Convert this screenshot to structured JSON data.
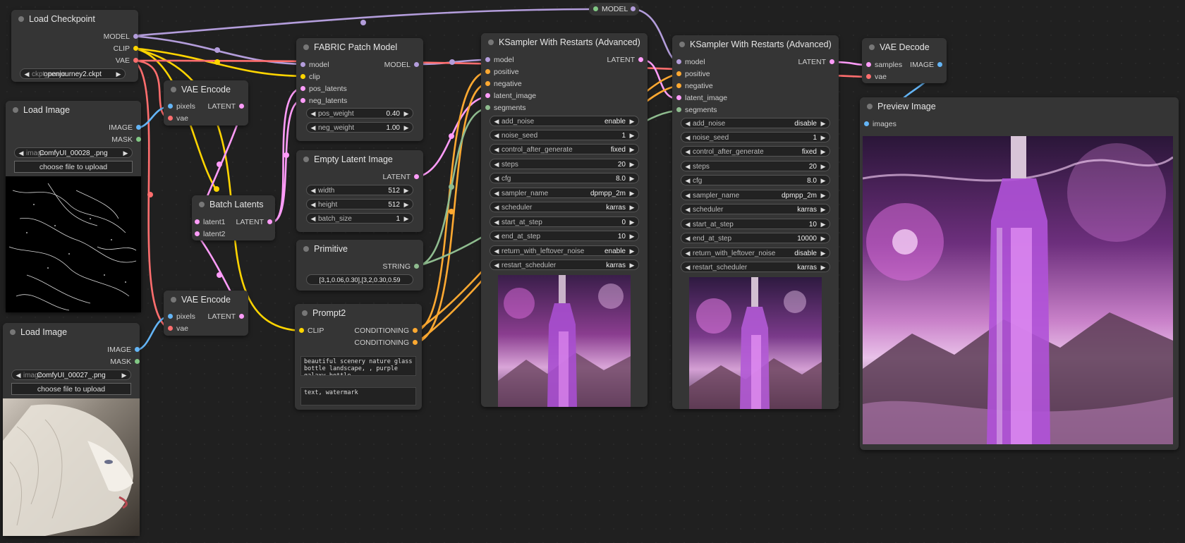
{
  "colors": {
    "model": "#b39ddb",
    "clip": "#ffd500",
    "vae": "#ff6e6e",
    "image": "#64b5f6",
    "mask": "#81c784",
    "latent": "#ff9cf9",
    "conditioning": "#ffa931",
    "string": "#8fbc8f"
  },
  "model_reroute": {
    "label": "MODEL"
  },
  "load_checkpoint": {
    "title": "Load Checkpoint",
    "outputs": [
      "MODEL",
      "CLIP",
      "VAE"
    ],
    "ckpt_label": "ckpt_name",
    "ckpt_value": "openjourney2.ckpt"
  },
  "load_image_1": {
    "title": "Load Image",
    "outputs": [
      "IMAGE",
      "MASK"
    ],
    "image_label": "image",
    "image_value": "ComfyUI_00028_.png",
    "upload_label": "choose file to upload"
  },
  "load_image_2": {
    "title": "Load Image",
    "outputs": [
      "IMAGE",
      "MASK"
    ],
    "image_label": "image",
    "image_value": "ComfyUI_00027_.png",
    "upload_label": "choose file to upload"
  },
  "vae_encode_1": {
    "title": "VAE Encode",
    "inputs": [
      "pixels",
      "vae"
    ],
    "output": "LATENT"
  },
  "vae_encode_2": {
    "title": "VAE Encode",
    "inputs": [
      "pixels",
      "vae"
    ],
    "output": "LATENT"
  },
  "batch_latents": {
    "title": "Batch Latents",
    "inputs": [
      "latent1",
      "latent2"
    ],
    "output": "LATENT"
  },
  "fabric": {
    "title": "FABRIC Patch Model",
    "inputs": [
      "model",
      "clip",
      "pos_latents",
      "neg_latents"
    ],
    "output": "MODEL",
    "widgets": [
      {
        "label": "pos_weight",
        "value": "0.40"
      },
      {
        "label": "neg_weight",
        "value": "1.00"
      }
    ]
  },
  "empty_latent": {
    "title": "Empty Latent Image",
    "output": "LATENT",
    "widgets": [
      {
        "label": "width",
        "value": "512"
      },
      {
        "label": "height",
        "value": "512"
      },
      {
        "label": "batch_size",
        "value": "1"
      }
    ]
  },
  "primitive": {
    "title": "Primitive",
    "output": "STRING",
    "value": "[3,1,0.06,0.30],[3,2,0.30,0.59"
  },
  "prompt2": {
    "title": "Prompt2",
    "input": "CLIP",
    "outputs": [
      "CONDITIONING",
      "CONDITIONING"
    ],
    "positive_text": "beautiful scenery nature glass bottle landscape, , purple galaxy bottle,",
    "negative_text": "text, watermark"
  },
  "ksampler_1": {
    "title": "KSampler With Restarts (Advanced)",
    "inputs": [
      "model",
      "positive",
      "negative",
      "latent_image",
      "segments"
    ],
    "output": "LATENT",
    "widgets": [
      {
        "label": "add_noise",
        "value": "enable"
      },
      {
        "label": "noise_seed",
        "value": "1"
      },
      {
        "label": "control_after_generate",
        "value": "fixed"
      },
      {
        "label": "steps",
        "value": "20"
      },
      {
        "label": "cfg",
        "value": "8.0"
      },
      {
        "label": "sampler_name",
        "value": "dpmpp_2m"
      },
      {
        "label": "scheduler",
        "value": "karras"
      },
      {
        "label": "start_at_step",
        "value": "0"
      },
      {
        "label": "end_at_step",
        "value": "10"
      },
      {
        "label": "return_with_leftover_noise",
        "value": "enable"
      },
      {
        "label": "restart_scheduler",
        "value": "karras"
      }
    ]
  },
  "ksampler_2": {
    "title": "KSampler With Restarts (Advanced)",
    "inputs": [
      "model",
      "positive",
      "negative",
      "latent_image",
      "segments"
    ],
    "output": "LATENT",
    "widgets": [
      {
        "label": "add_noise",
        "value": "disable"
      },
      {
        "label": "noise_seed",
        "value": "1"
      },
      {
        "label": "control_after_generate",
        "value": "fixed"
      },
      {
        "label": "steps",
        "value": "20"
      },
      {
        "label": "cfg",
        "value": "8.0"
      },
      {
        "label": "sampler_name",
        "value": "dpmpp_2m"
      },
      {
        "label": "scheduler",
        "value": "karras"
      },
      {
        "label": "start_at_step",
        "value": "10"
      },
      {
        "label": "end_at_step",
        "value": "10000"
      },
      {
        "label": "return_with_leftover_noise",
        "value": "disable"
      },
      {
        "label": "restart_scheduler",
        "value": "karras"
      }
    ]
  },
  "vae_decode": {
    "title": "VAE Decode",
    "inputs": [
      "samples",
      "vae"
    ],
    "output": "IMAGE"
  },
  "preview": {
    "title": "Preview Image",
    "input": "images"
  }
}
